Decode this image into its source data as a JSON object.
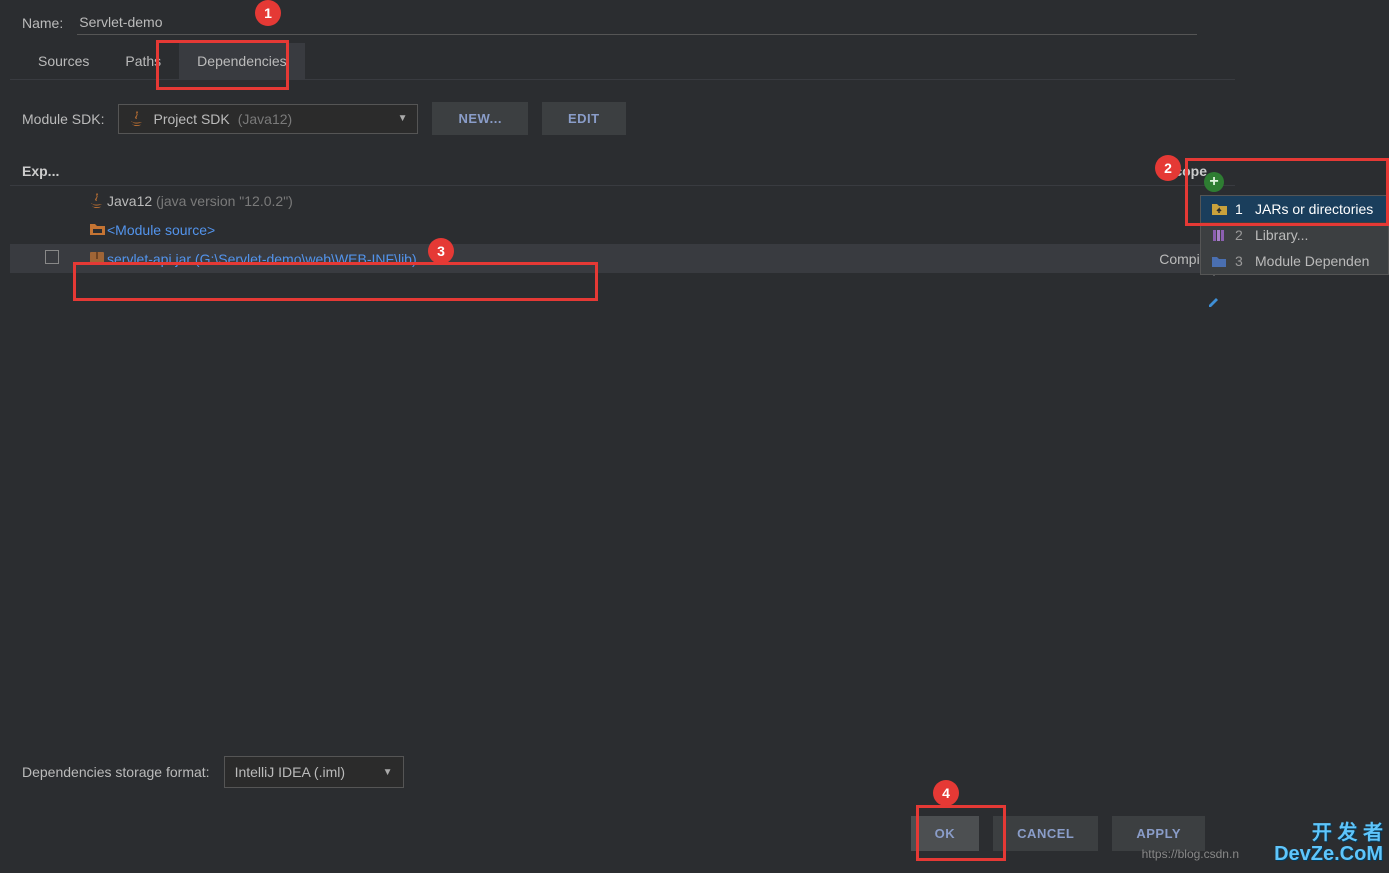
{
  "name": {
    "label": "Name:",
    "value": "Servlet-demo"
  },
  "tabs": {
    "sources": "Sources",
    "paths": "Paths",
    "dependencies": "Dependencies"
  },
  "moduleSdk": {
    "label": "Module SDK:",
    "selected_name": "Project SDK ",
    "selected_suffix": "(Java12)",
    "new_label": "NEW...",
    "edit_label": "EDIT"
  },
  "columns": {
    "export": "Exp...",
    "scope": "Scope"
  },
  "deps": {
    "java": {
      "name": "Java12 ",
      "version": "(java version \"12.0.2\")"
    },
    "module_source": "<Module source>",
    "servlet": {
      "name": "servlet-api.jar (G:\\Servlet-demo\\web\\WEB-INF\\lib)",
      "scope": "Compile"
    }
  },
  "storage": {
    "label": "Dependencies storage format:",
    "value": "IntelliJ IDEA (.iml)"
  },
  "buttons": {
    "ok": "OK",
    "cancel": "CANCEL",
    "apply": "APPLY"
  },
  "popup": {
    "item1": {
      "num": "1",
      "label": "JARs or directories"
    },
    "item2": {
      "num": "2",
      "label": "Library..."
    },
    "item3": {
      "num": "3",
      "label": "Module Dependen"
    }
  },
  "callouts": {
    "c1": "1",
    "c2": "2",
    "c3": "3",
    "c4": "4"
  },
  "watermark": {
    "top": "开 发 者",
    "bottom": "DevZe.CoM",
    "url": "https://blog.csdn.n"
  }
}
